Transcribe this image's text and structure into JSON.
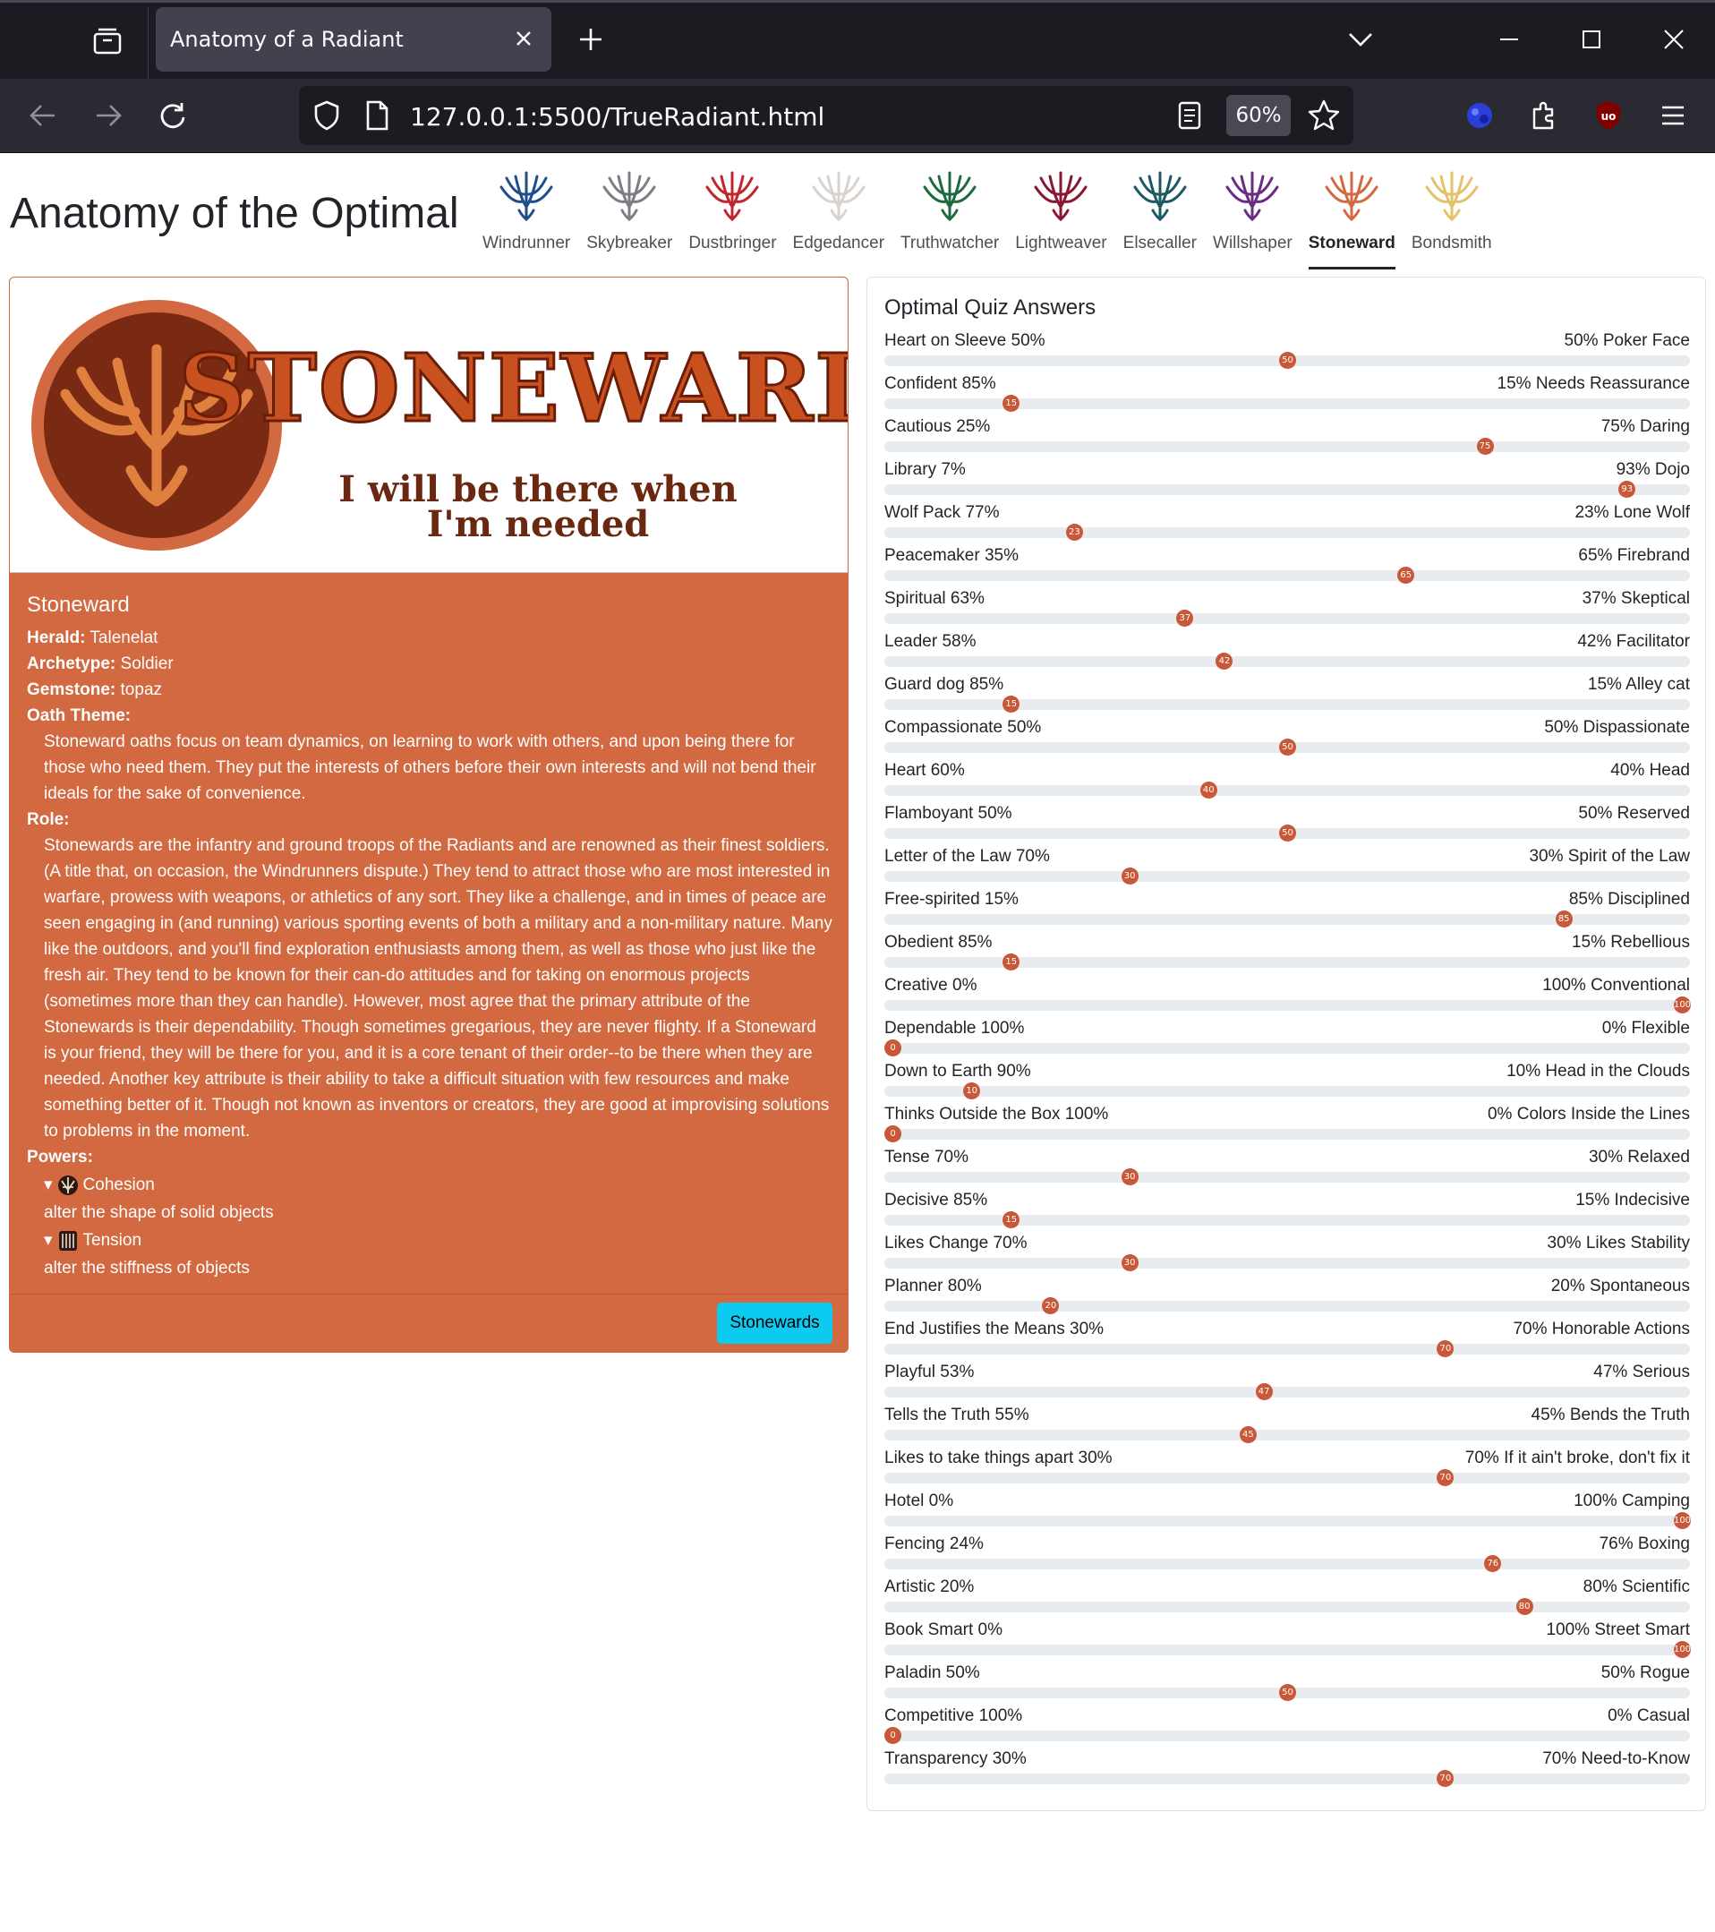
{
  "browser": {
    "tab_title": "Anatomy of a Radiant",
    "url": "127.0.0.1:5500/TrueRadiant.html",
    "zoom": "60%"
  },
  "page": {
    "title": "Anatomy of the Optimal",
    "orders": [
      {
        "label": "Windrunner",
        "color": "#1f4e8c"
      },
      {
        "label": "Skybreaker",
        "color": "#7d7d86"
      },
      {
        "label": "Dustbringer",
        "color": "#c0262b"
      },
      {
        "label": "Edgedancer",
        "color": "#d9d3cf"
      },
      {
        "label": "Truthwatcher",
        "color": "#1d6b3c"
      },
      {
        "label": "Lightweaver",
        "color": "#8a1730"
      },
      {
        "label": "Elsecaller",
        "color": "#1c5a62"
      },
      {
        "label": "Willshaper",
        "color": "#6b2d84"
      },
      {
        "label": "Stoneward",
        "color": "#d26940"
      },
      {
        "label": "Bondsmith",
        "color": "#e3c26a"
      }
    ],
    "active_order": "Stoneward"
  },
  "banner": {
    "word": "STONEWARD",
    "motto_line1": "I will be there when",
    "motto_line2": "I'm needed"
  },
  "card": {
    "title": "Stoneward",
    "herald_label": "Herald:",
    "herald": "Talenelat",
    "archetype_label": "Archetype:",
    "archetype": "Soldier",
    "gemstone_label": "Gemstone:",
    "gemstone": "topaz",
    "oath_label": "Oath Theme:",
    "oath": "Stoneward oaths focus on team dynamics, on learning to work with others, and upon being there for those who need them. They put the interests of others before their own interests and will not bend their ideals for the sake of convenience.",
    "role_label": "Role:",
    "role": "Stonewards are the infantry and ground troops of the Radiants and are renowned as their finest soldiers. (A title that, on occasion, the Windrunners dispute.) They tend to attract those who are most interested in warfare, prowess with weapons, or athletics of any sort. They like a challenge, and in times of peace are seen engaging in (and running) various sporting events of both a military and a non-military nature. Many like the outdoors, and you'll find exploration enthusiasts among them, as well as those who just like the fresh air. They tend to be known for their can-do attitudes and for taking on enormous projects (sometimes more than they can handle). However, most agree that the primary attribute of the Stonewards is their dependability. Though sometimes gregarious, they are never flighty. If a Stoneward is your friend, they will be there for you, and it is a core tenant of their order--to be there when they are needed. Another key attribute is their ability to take a difficult situation with few resources and make something better of it. Though not known as inventors or creators, they are good at improvising solutions to problems in the moment.",
    "powers_label": "Powers:",
    "powers": [
      {
        "name": "Cohesion",
        "desc": "alter the shape of solid objects"
      },
      {
        "name": "Tension",
        "desc": "alter the stiffness of objects"
      }
    ],
    "button_label": "Stonewards"
  },
  "quiz": {
    "title": "Optimal Quiz Answers",
    "accent_color": "#c9583a",
    "rows": [
      {
        "left": "Heart on Sleeve 50%",
        "right": "50% Poker Face",
        "value": 50
      },
      {
        "left": "Confident 85%",
        "right": "15% Needs Reassurance",
        "value": 15
      },
      {
        "left": "Cautious 25%",
        "right": "75% Daring",
        "value": 75
      },
      {
        "left": "Library 7%",
        "right": "93% Dojo",
        "value": 93
      },
      {
        "left": "Wolf Pack 77%",
        "right": "23% Lone Wolf",
        "value": 23
      },
      {
        "left": "Peacemaker 35%",
        "right": "65% Firebrand",
        "value": 65
      },
      {
        "left": "Spiritual 63%",
        "right": "37% Skeptical",
        "value": 37
      },
      {
        "left": "Leader 58%",
        "right": "42% Facilitator",
        "value": 42
      },
      {
        "left": "Guard dog 85%",
        "right": "15% Alley cat",
        "value": 15
      },
      {
        "left": "Compassionate 50%",
        "right": "50% Dispassionate",
        "value": 50
      },
      {
        "left": "Heart 60%",
        "right": "40% Head",
        "value": 40
      },
      {
        "left": "Flamboyant 50%",
        "right": "50% Reserved",
        "value": 50
      },
      {
        "left": "Letter of the Law 70%",
        "right": "30% Spirit of the Law",
        "value": 30
      },
      {
        "left": "Free-spirited 15%",
        "right": "85% Disciplined",
        "value": 85
      },
      {
        "left": "Obedient 85%",
        "right": "15% Rebellious",
        "value": 15
      },
      {
        "left": "Creative 0%",
        "right": "100% Conventional",
        "value": 100
      },
      {
        "left": "Dependable 100%",
        "right": "0% Flexible",
        "value": 0
      },
      {
        "left": "Down to Earth 90%",
        "right": "10% Head in the Clouds",
        "value": 10
      },
      {
        "left": "Thinks Outside the Box 100%",
        "right": "0% Colors Inside the Lines",
        "value": 0
      },
      {
        "left": "Tense 70%",
        "right": "30% Relaxed",
        "value": 30
      },
      {
        "left": "Decisive 85%",
        "right": "15% Indecisive",
        "value": 15
      },
      {
        "left": "Likes Change 70%",
        "right": "30% Likes Stability",
        "value": 30
      },
      {
        "left": "Planner 80%",
        "right": "20% Spontaneous",
        "value": 20
      },
      {
        "left": "End Justifies the Means 30%",
        "right": "70% Honorable Actions",
        "value": 70
      },
      {
        "left": "Playful 53%",
        "right": "47% Serious",
        "value": 47
      },
      {
        "left": "Tells the Truth 55%",
        "right": "45% Bends the Truth",
        "value": 45
      },
      {
        "left": "Likes to take things apart 30%",
        "right": "70% If it ain't broke, don't fix it",
        "value": 70
      },
      {
        "left": "Hotel 0%",
        "right": "100% Camping",
        "value": 100
      },
      {
        "left": "Fencing 24%",
        "right": "76% Boxing",
        "value": 76
      },
      {
        "left": "Artistic 20%",
        "right": "80% Scientific",
        "value": 80
      },
      {
        "left": "Book Smart 0%",
        "right": "100% Street Smart",
        "value": 100
      },
      {
        "left": "Paladin 50%",
        "right": "50% Rogue",
        "value": 50
      },
      {
        "left": "Competitive 100%",
        "right": "0% Casual",
        "value": 0
      },
      {
        "left": "Transparency 30%",
        "right": "70% Need-to-Know",
        "value": 70
      }
    ]
  }
}
